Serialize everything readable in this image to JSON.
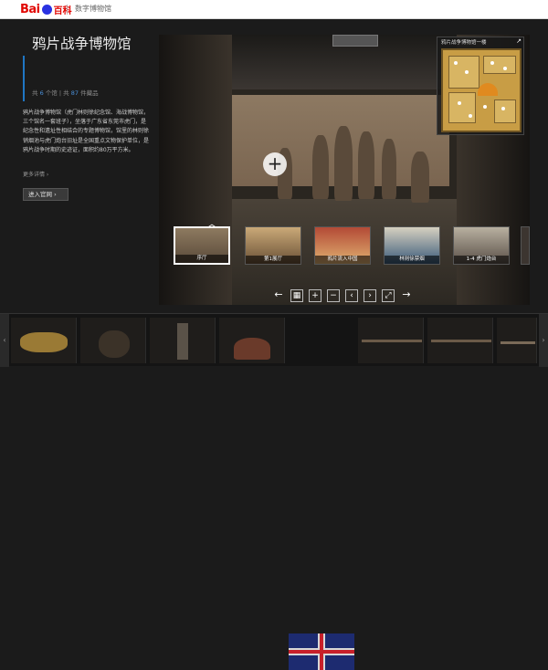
{
  "header": {
    "logo_bai": "Bai",
    "logo_baike": "百科",
    "section_title": "数字博物馆"
  },
  "museum": {
    "title": "鸦片战争博物馆",
    "stats_prefix": "共",
    "hall_count": "6",
    "hall_suffix": "个馆",
    "sep": "|",
    "stats_prefix2": "共",
    "collection_count": "87",
    "collection_suffix": "件藏品",
    "intro": "鸦片战争博物馆（虎门林则徐纪念馆、海战博物馆，三个馆名一套班子），坐落于广东省东莞市虎门，是纪念性和遗址性相结合的专题博物馆，馆里的林则徐销烟池与虎门炮台旧址是全国重点文物保护单位，是鸦片战争时期的史迹证，面积约80万平方米。",
    "more_label": "更多详情 ›",
    "enter_label": "进入官网 ›"
  },
  "viewer": {
    "minimap_title": "鸦片战争博物馆一楼",
    "thumbnails": [
      {
        "label": "序厅",
        "active": true
      },
      {
        "label": "第1展厅",
        "active": false
      },
      {
        "label": "鸦片流入中国",
        "active": false
      },
      {
        "label": "林则徐禁烟",
        "active": false
      },
      {
        "label": "1-4 虎门炮台",
        "active": false
      }
    ],
    "controls": [
      "‹",
      "grid-icon",
      "zoom-in-icon",
      "zoom-out-icon",
      "rotate-left-icon",
      "rotate-right-icon",
      "fullscreen-icon",
      "›"
    ]
  },
  "strip": {
    "items": [
      "fire-pot",
      "bronze-pot",
      "cannon-tube",
      "leather-bag",
      "union-flag",
      "rifle-1",
      "rifle-2"
    ]
  },
  "colors": {
    "accent": "#1f76c4",
    "logo_red": "#e10602",
    "background": "#1b1b1b"
  }
}
